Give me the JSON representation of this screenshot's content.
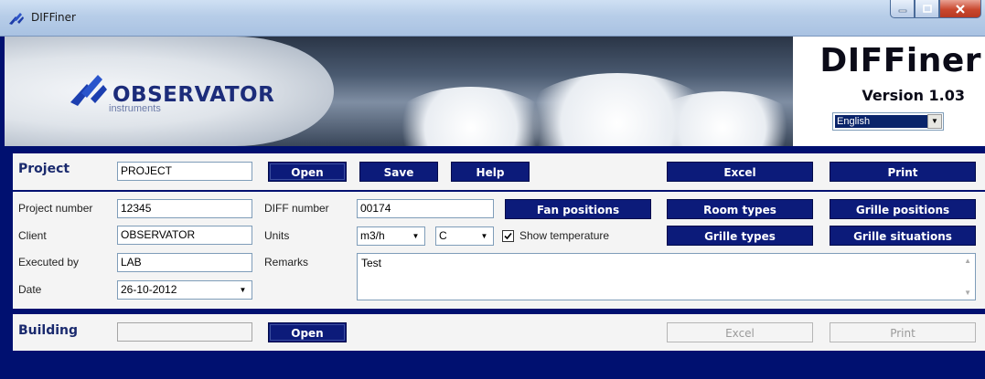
{
  "window": {
    "title": "DIFFiner"
  },
  "banner": {
    "logo_text": "OBSERVATOR",
    "logo_sub": "instruments",
    "product_title": "DIFFiner",
    "product_version": "Version 1.03",
    "language_value": "English"
  },
  "project": {
    "label": "Project",
    "name_value": "PROJECT",
    "open_label": "Open",
    "save_label": "Save",
    "help_label": "Help",
    "excel_label": "Excel",
    "print_label": "Print"
  },
  "details": {
    "project_number_label": "Project number",
    "project_number_value": "12345",
    "client_label": "Client",
    "client_value": "OBSERVATOR",
    "executed_by_label": "Executed by",
    "executed_by_value": "LAB",
    "date_label": "Date",
    "date_value": "26-10-2012",
    "diff_number_label": "DIFF number",
    "diff_number_value": "00174",
    "units_label": "Units",
    "units_flow_value": "m3/h",
    "units_temp_value": "C",
    "show_temperature_label": "Show temperature",
    "show_temperature_checked": true,
    "remarks_label": "Remarks",
    "remarks_value": "Test",
    "fan_positions_label": "Fan positions",
    "room_types_label": "Room types",
    "grille_positions_label": "Grille positions",
    "grille_types_label": "Grille types",
    "grille_situations_label": "Grille situations"
  },
  "building": {
    "label": "Building",
    "name_value": "",
    "open_label": "Open",
    "excel_label": "Excel",
    "print_label": "Print"
  }
}
